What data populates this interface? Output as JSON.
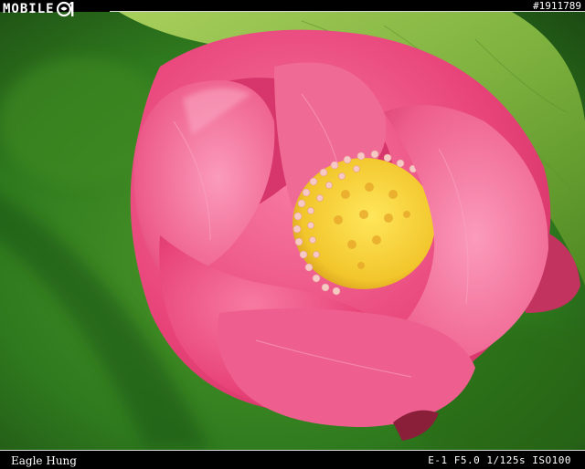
{
  "header": {
    "logo_text": "MOBILE",
    "photo_id": "#1911789"
  },
  "footer": {
    "photographer": "Eagle  Hung",
    "exif": "E-1 F5.0 1/125s ISO100"
  },
  "photo": {
    "subject": "pink-lotus-bud",
    "colors": {
      "petal": "#e8447a",
      "petal_light": "#f58fb1",
      "center": "#f3d23a",
      "stamen": "#f7c9c4",
      "leaf": "#6fa83a",
      "background": "#2f7a1e"
    }
  }
}
